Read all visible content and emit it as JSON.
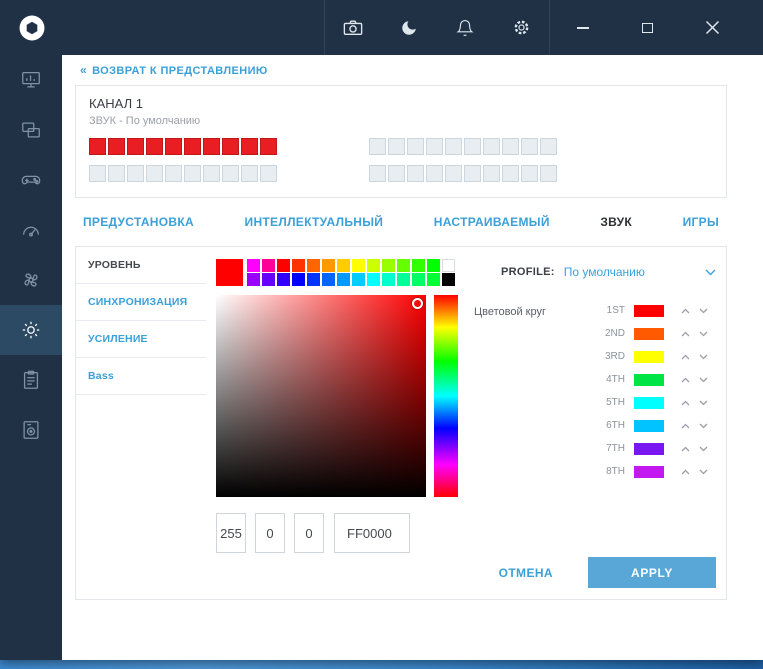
{
  "titlebar": {
    "icons": [
      {
        "id": "camera"
      },
      {
        "id": "moon"
      },
      {
        "id": "bell"
      },
      {
        "id": "gear"
      }
    ],
    "controls": [
      "minimize",
      "maximize",
      "close"
    ]
  },
  "back_link": {
    "chevrons": "«",
    "label": "ВОЗВРАТ К ПРЕДСТАВЛЕНИЮ"
  },
  "channel": {
    "title": "КАНАЛ 1",
    "subtitle": "ЗВУК - По умолчанию",
    "led": {
      "on_color": "#e81e22",
      "rows": [
        {
          "left": [
            1,
            1,
            1,
            1,
            1,
            1,
            1,
            1,
            1,
            1
          ],
          "right": [
            0,
            0,
            0,
            0,
            0,
            0,
            0,
            0,
            0,
            0
          ]
        },
        {
          "left": [
            0,
            0,
            0,
            0,
            0,
            0,
            0,
            0,
            0,
            0
          ],
          "right": [
            0,
            0,
            0,
            0,
            0,
            0,
            0,
            0,
            0,
            0
          ]
        }
      ]
    }
  },
  "tabs": [
    {
      "id": "preset",
      "label": "ПРЕДУСТАНОВКА",
      "active": false
    },
    {
      "id": "smart",
      "label": "ИНТЕЛЛЕКТУАЛЬНЫЙ",
      "active": false
    },
    {
      "id": "custom",
      "label": "НАСТРАИВАЕМЫЙ",
      "active": false
    },
    {
      "id": "audio",
      "label": "ЗВУК",
      "active": true
    },
    {
      "id": "games",
      "label": "ИГРЫ",
      "active": false
    }
  ],
  "side_menu": [
    {
      "id": "level",
      "label": "УРОВЕНЬ",
      "active": true
    },
    {
      "id": "sync",
      "label": "СИНХРОНИЗАЦИЯ",
      "active": false
    },
    {
      "id": "gain",
      "label": "УСИЛЕНИЕ",
      "active": false
    },
    {
      "id": "bass",
      "label": "Bass",
      "active": false
    }
  ],
  "picker": {
    "selected_color": "#ff0000",
    "palette_large": "#ff0000",
    "palette_rows": [
      [
        "#ff00ff",
        "#ff0099",
        "#ff0000",
        "#ff3300",
        "#ff6600",
        "#ff9900",
        "#ffcc00",
        "#ffff00",
        "#ccff00",
        "#99ff00",
        "#66ff00",
        "#33ff00",
        "#00ff00",
        "#ffffff"
      ],
      [
        "#9900ff",
        "#6600ff",
        "#3300ff",
        "#0000ff",
        "#0033ff",
        "#0066ff",
        "#0099ff",
        "#00ccff",
        "#00ffff",
        "#00ffcc",
        "#00ff99",
        "#00ff66",
        "#00ff33",
        "#000000"
      ]
    ],
    "r": "255",
    "g": "0",
    "b": "0",
    "hex": "FF0000"
  },
  "profile": {
    "label": "PROFILE:",
    "value": "По умолчанию"
  },
  "color_wheel": {
    "title": "Цветовой круг",
    "entries": [
      {
        "label": "1ST",
        "color": "#ff0000"
      },
      {
        "label": "2ND",
        "color": "#ff5a00"
      },
      {
        "label": "3RD",
        "color": "#ffff00"
      },
      {
        "label": "4TH",
        "color": "#00e545"
      },
      {
        "label": "5TH",
        "color": "#00ffff"
      },
      {
        "label": "6TH",
        "color": "#00c3ff"
      },
      {
        "label": "7TH",
        "color": "#7a16f2"
      },
      {
        "label": "8TH",
        "color": "#c319f0"
      }
    ]
  },
  "footer": {
    "cancel": "ОТМЕНА",
    "apply": "APPLY"
  },
  "colors": {
    "accent": "#3aa0d8",
    "titlebar": "#203145",
    "apply_bg": "#58a7d7",
    "led_on": "#e81e22"
  }
}
